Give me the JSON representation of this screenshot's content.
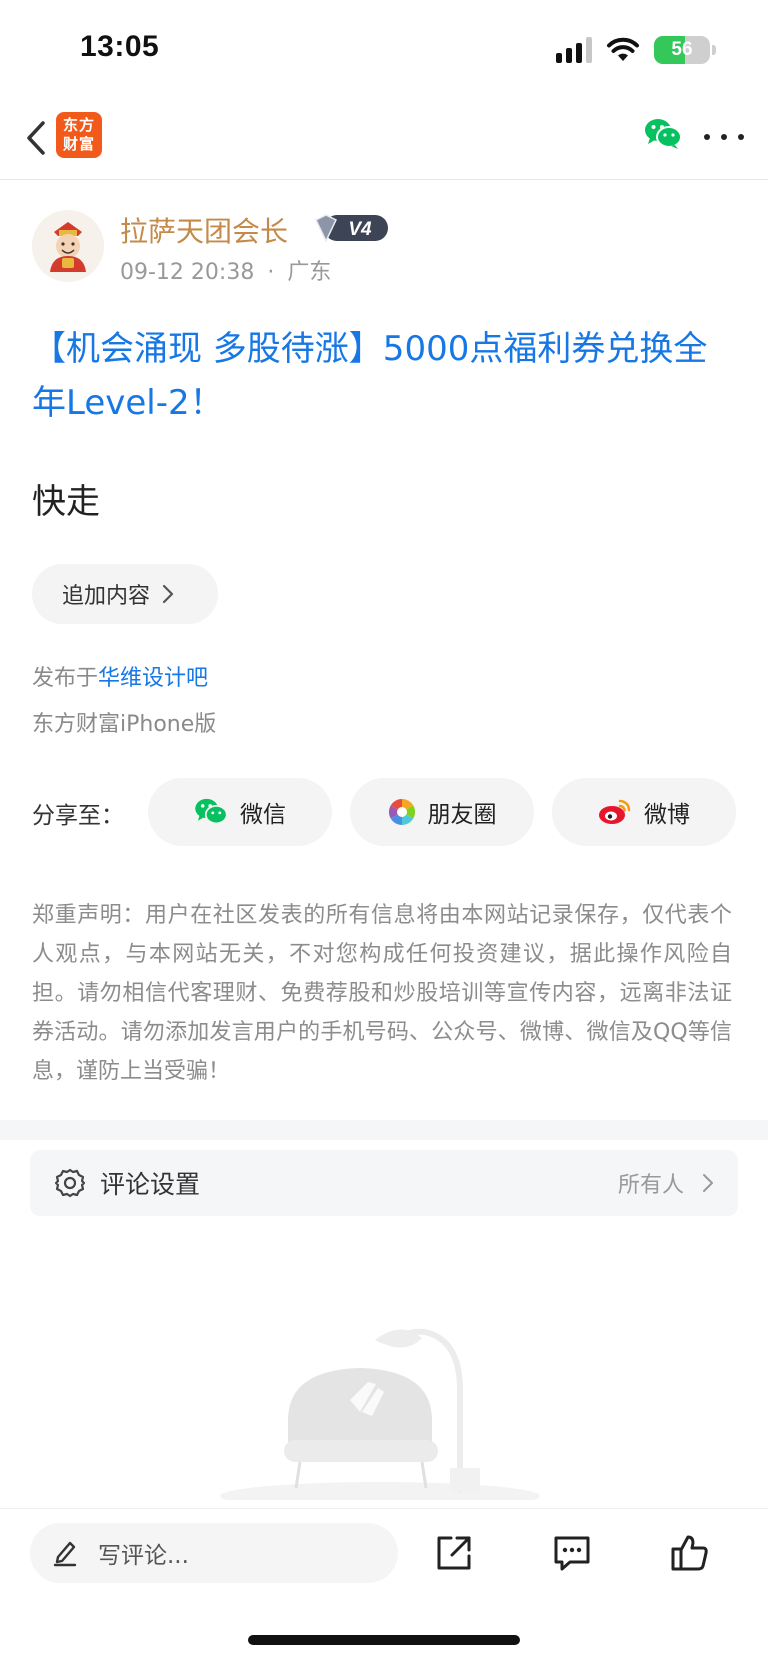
{
  "status_bar": {
    "time": "13:05",
    "battery_level": "56",
    "battery_fraction": 0.56,
    "signal_bars_active": 3,
    "signal_bars_total": 4
  },
  "nav": {
    "logo_text": "东方财富",
    "logo_color": "#f25a1b",
    "icons": [
      "back-icon",
      "wechat-icon",
      "more-icon"
    ]
  },
  "author": {
    "name": "拉萨天团会长",
    "level": "V4",
    "date": "09-12 20:38",
    "separator": "·",
    "region": "广东"
  },
  "post": {
    "title": "【机会涌现 多股待涨】5000点福利券兑换全年Level-2！",
    "body": "快走",
    "append_label": "追加内容",
    "publish_prefix": "发布于",
    "forum": "华维设计吧",
    "client": "东方财富iPhone版"
  },
  "share": {
    "label": "分享至：",
    "wechat": "微信",
    "moments": "朋友圈",
    "weibo": "微博"
  },
  "disclaimer": "郑重声明：用户在社区发表的所有信息将由本网站记录保存，仅代表个人观点，与本网站无关，不对您构成任何投资建议，据此操作风险自担。请勿相信代客理财、免费荐股和炒股培训等宣传内容，远离非法证券活动。请勿添加发言用户的手机号码、公众号、微博、微信及QQ等信息，谨防上当受骗！",
  "comment_settings": {
    "label": "评论设置",
    "value": "所有人"
  },
  "bottom_bar": {
    "comment_placeholder": "写评论..."
  },
  "colors": {
    "link_blue": "#1677e5",
    "author_gold": "#c48a4a",
    "wechat_green": "#07c160"
  }
}
